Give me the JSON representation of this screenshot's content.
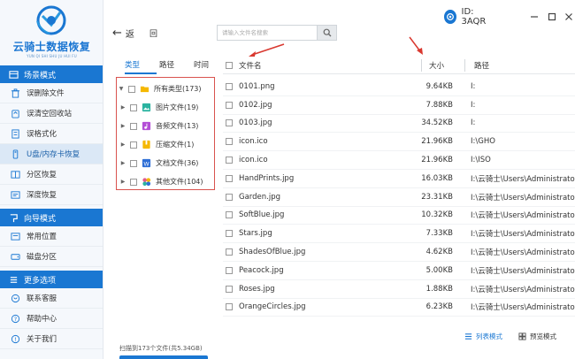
{
  "app": {
    "logo_title": "云骑士数据恢复",
    "logo_sub": "YUN QI SHI SHU JU HUI FU",
    "id_label": "ID: 3AQR"
  },
  "colors": {
    "accent": "#1a77d2",
    "sidebar_bg": "#f5f8fc",
    "highlight_box": "#d9534f"
  },
  "sidebar": {
    "section1": "场景模式",
    "section1_items": [
      {
        "label": "误删除文件",
        "icon": "trash-icon"
      },
      {
        "label": "误清空回收站",
        "icon": "recycle-bin-icon"
      },
      {
        "label": "误格式化",
        "icon": "format-icon"
      },
      {
        "label": "U盘/内存卡恢复",
        "icon": "usb-icon"
      },
      {
        "label": "分区恢复",
        "icon": "partition-icon"
      },
      {
        "label": "深度恢复",
        "icon": "deep-scan-icon"
      }
    ],
    "section2": "向导模式",
    "section2_items": [
      {
        "label": "常用位置",
        "icon": "location-icon"
      },
      {
        "label": "磁盘分区",
        "icon": "disk-icon"
      }
    ],
    "section3": "更多选项",
    "section3_items": [
      {
        "label": "联系客服",
        "icon": "support-icon"
      },
      {
        "label": "帮助中心",
        "icon": "help-icon"
      },
      {
        "label": "关于我们",
        "icon": "info-icon"
      }
    ]
  },
  "toolbar": {
    "back_label": "返",
    "home_label": "回",
    "search_placeholder": "请输入文件名搜索"
  },
  "tree": {
    "tabs": [
      "类型",
      "路径",
      "时间"
    ],
    "active_tab": "类型",
    "root": "所有类型(173)",
    "children": [
      {
        "label": "图片文件(19)",
        "icon": "image-file-icon",
        "color": "#2bb3a0"
      },
      {
        "label": "音频文件(13)",
        "icon": "audio-file-icon",
        "color": "#b44fd6"
      },
      {
        "label": "压缩文件(1)",
        "icon": "archive-file-icon",
        "color": "#f5b800"
      },
      {
        "label": "文档文件(36)",
        "icon": "document-file-icon",
        "color": "#2f6fd6"
      },
      {
        "label": "其他文件(104)",
        "icon": "other-file-icon",
        "color": "#e25a8c"
      }
    ]
  },
  "file_list": {
    "headers": {
      "name": "文件名",
      "size": "大小",
      "path": "路径"
    },
    "rows": [
      {
        "name": "0101.png",
        "size": "9.64KB",
        "path": "I:"
      },
      {
        "name": "0102.jpg",
        "size": "7.88KB",
        "path": "I:"
      },
      {
        "name": "0103.jpg",
        "size": "34.52KB",
        "path": "I:"
      },
      {
        "name": "icon.ico",
        "size": "21.96KB",
        "path": "I:\\GHO"
      },
      {
        "name": "icon.ico",
        "size": "21.96KB",
        "path": "I:\\ISO"
      },
      {
        "name": "HandPrints.jpg",
        "size": "16.03KB",
        "path": "I:\\云骑士\\Users\\Administrator\\"
      },
      {
        "name": "Garden.jpg",
        "size": "23.31KB",
        "path": "I:\\云骑士\\Users\\Administrator\\"
      },
      {
        "name": "SoftBlue.jpg",
        "size": "10.32KB",
        "path": "I:\\云骑士\\Users\\Administrator\\"
      },
      {
        "name": "Stars.jpg",
        "size": "7.33KB",
        "path": "I:\\云骑士\\Users\\Administrator\\"
      },
      {
        "name": "ShadesOfBlue.jpg",
        "size": "4.62KB",
        "path": "I:\\云骑士\\Users\\Administrator\\"
      },
      {
        "name": "Peacock.jpg",
        "size": "5.00KB",
        "path": "I:\\云骑士\\Users\\Administrator\\"
      },
      {
        "name": "Roses.jpg",
        "size": "1.88KB",
        "path": "I:\\云骑士\\Users\\Administrator\\"
      },
      {
        "name": "OrangeCircles.jpg",
        "size": "6.23KB",
        "path": "I:\\云骑士\\Users\\Administrator\\"
      }
    ]
  },
  "status": {
    "scan_text": "扫描到173个文件(共5.34GB)"
  },
  "view_switch": {
    "list_label": "列表模式",
    "preview_label": "预览模式"
  }
}
